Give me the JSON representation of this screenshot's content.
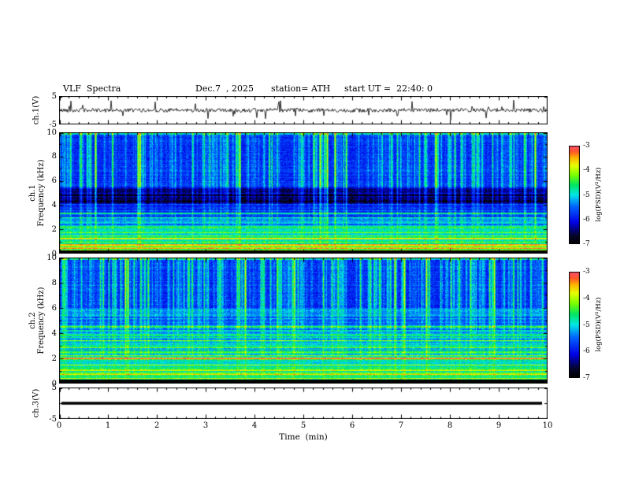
{
  "header": {
    "title": "VLF  Spectra",
    "date": "Dec.7  , 2025",
    "station": "station= ATH",
    "start_ut": "start UT =  22:40: 0"
  },
  "xaxis": {
    "label": "Time  (min)",
    "ticks": [
      "0",
      "1",
      "2",
      "3",
      "4",
      "5",
      "6",
      "7",
      "8",
      "9",
      "10"
    ]
  },
  "panels": {
    "wave1": {
      "ylabel": "ch.1(V)",
      "yticks": [
        "5",
        "-5"
      ],
      "ylim": [
        -5,
        5
      ]
    },
    "spec1": {
      "ylabel_ch": "ch.1",
      "ylabel_freq": "Frequency (kHz)",
      "yticks": [
        "10",
        "8",
        "6",
        "4",
        "2",
        "0"
      ],
      "ylim": [
        0,
        10
      ]
    },
    "spec2": {
      "ylabel_ch": "ch.2",
      "ylabel_freq": "Frequency (kHz)",
      "yticks": [
        "10",
        "8",
        "6",
        "4",
        "2",
        "0"
      ],
      "ylim": [
        0,
        10
      ]
    },
    "wave3": {
      "ylabel": "ch.3(V)",
      "yticks": [
        "5",
        "-5"
      ],
      "ylim": [
        -5,
        5
      ]
    }
  },
  "colorbars": {
    "label": "log(PSD)(V²/Hz)",
    "ticks": [
      "-3",
      "-4",
      "-5",
      "-6",
      "-7"
    ],
    "range": [
      -7,
      -3
    ]
  },
  "colors": {
    "background": "#ffffff",
    "axis": "#000000",
    "colormap_stops": [
      [
        0.0,
        "#000000"
      ],
      [
        0.08,
        "#050528"
      ],
      [
        0.22,
        "#0000e6"
      ],
      [
        0.38,
        "#0064ff"
      ],
      [
        0.5,
        "#00e6e6"
      ],
      [
        0.6,
        "#00e664"
      ],
      [
        0.7,
        "#78ff00"
      ],
      [
        0.8,
        "#e6ff00"
      ],
      [
        0.88,
        "#ffb400"
      ],
      [
        0.94,
        "#ff5a28"
      ],
      [
        1.0,
        "#ff506e"
      ]
    ]
  },
  "chart_data": [
    {
      "type": "line",
      "panel": "ch.1 time series",
      "xlabel": "Time (min)",
      "xlim": [
        0,
        10
      ],
      "ylabel": "ch.1(V)",
      "ylim": [
        -5,
        5
      ],
      "yticks": [
        5,
        -5
      ],
      "description": "Broadband noise trace centred near 0 V with frequent impulsive sferic spikes of roughly ±1 to ±3.5 V throughout the 10-minute record."
    },
    {
      "type": "heatmap",
      "panel": "ch.1 spectrogram",
      "xlabel": "Time (min)",
      "xlim": [
        0,
        10
      ],
      "ylabel": "Frequency (kHz)",
      "ylim": [
        0,
        10
      ],
      "yticks": [
        0,
        2,
        4,
        6,
        8,
        10
      ],
      "zlabel": "log(PSD)(V²/Hz)",
      "zlim": [
        -7,
        -3
      ],
      "bands": [
        {
          "f": [
            0,
            0.32
          ],
          "level": -7.2
        },
        {
          "f": [
            0.32,
            0.9
          ],
          "level": -4.55
        },
        {
          "f": [
            0.9,
            1.6
          ],
          "level": -4.8
        },
        {
          "f": [
            1.6,
            2.4
          ],
          "level": -5.05
        },
        {
          "f": [
            2.4,
            3.0
          ],
          "level": -5.4
        },
        {
          "f": [
            3.0,
            4.1
          ],
          "level": -5.9
        },
        {
          "f": [
            4.1,
            5.5
          ],
          "level": -6.5
        },
        {
          "f": [
            5.5,
            10
          ],
          "level": -5.85
        }
      ],
      "lines": [
        {
          "f": 9.95,
          "w": 0.1,
          "level": -5.1
        },
        {
          "f": 4.85,
          "w": 0.07,
          "level": -6.9
        },
        {
          "f": 4.35,
          "w": 0.07,
          "level": -6.9
        },
        {
          "f": 3.35,
          "w": 0.07,
          "level": -5.0
        },
        {
          "f": 3.0,
          "w": 0.06,
          "level": -5.15
        },
        {
          "f": 2.15,
          "w": 0.06,
          "level": -4.6
        },
        {
          "f": 1.75,
          "w": 0.06,
          "level": -4.5
        },
        {
          "f": 1.3,
          "w": 0.07,
          "level": -4.3
        },
        {
          "f": 1.0,
          "w": 0.06,
          "level": -4.35
        },
        {
          "f": 0.72,
          "w": 0.06,
          "level": -3.6
        },
        {
          "f": 0.5,
          "w": 0.05,
          "level": -3.9
        },
        {
          "f": 0.36,
          "w": 0.04,
          "level": -4.2
        }
      ],
      "streaks": {
        "prob": 0.45,
        "strong": 8,
        "mask": [
          {
            "f": [
              0.32,
              0.9
            ],
            "gain": 0.15
          },
          {
            "f": [
              0.9,
              2.4
            ],
            "gain": 0.25
          },
          {
            "f": [
              2.4,
              4.1
            ],
            "gain": 0.45
          },
          {
            "f": [
              4.1,
              5.5
            ],
            "gain": 0.75
          },
          {
            "f": [
              5.5,
              10
            ],
            "gain": 1.0
          }
        ]
      },
      "row_noise": [
        {
          "f": [
            0.32,
            2.4
          ],
          "amp": 0.5
        },
        {
          "f": [
            2.4,
            4.1
          ],
          "amp": 0.3
        },
        {
          "f": [
            4.1,
            5.5
          ],
          "amp": 0.25
        },
        {
          "f": [
            5.5,
            10
          ],
          "amp": 0.12
        }
      ],
      "features": [
        "dense vertical impulsive streaks (sferics) above ~5.5 kHz on a blue ~-6 background",
        "quiet dark-blue band between ~4.1 and 5.5 kHz",
        "green band with horizontal striations between ~1 and 3 kHz",
        "strong yellow-to-red narrow horizontal lines between ~0.4 and 1.8 kHz",
        "black band below ~0.3 kHz"
      ]
    },
    {
      "type": "heatmap",
      "panel": "ch.2 spectrogram",
      "xlabel": "Time (min)",
      "xlim": [
        0,
        10
      ],
      "ylabel": "Frequency (kHz)",
      "ylim": [
        0,
        10
      ],
      "yticks": [
        0,
        2,
        4,
        6,
        8,
        10
      ],
      "zlabel": "log(PSD)(V²/Hz)",
      "zlim": [
        -7,
        -3
      ],
      "bands": [
        {
          "f": [
            0,
            0.32
          ],
          "level": -7.2
        },
        {
          "f": [
            0.32,
            0.9
          ],
          "level": -4.45
        },
        {
          "f": [
            0.9,
            1.9
          ],
          "level": -4.8
        },
        {
          "f": [
            1.9,
            2.3
          ],
          "level": -4.5
        },
        {
          "f": [
            2.3,
            4.3
          ],
          "level": -5.15
        },
        {
          "f": [
            4.3,
            5.0
          ],
          "level": -5.55
        },
        {
          "f": [
            5.0,
            6.0
          ],
          "level": -5.6
        },
        {
          "f": [
            6.0,
            10
          ],
          "level": -5.85
        }
      ],
      "lines": [
        {
          "f": 9.95,
          "w": 0.1,
          "level": -5.1
        },
        {
          "f": 4.55,
          "w": 0.07,
          "level": -4.9
        },
        {
          "f": 3.9,
          "w": 0.07,
          "level": -4.7
        },
        {
          "f": 3.4,
          "w": 0.07,
          "level": -4.7
        },
        {
          "f": 2.9,
          "w": 0.07,
          "level": -4.6
        },
        {
          "f": 2.5,
          "w": 0.06,
          "level": -4.5
        },
        {
          "f": 2.05,
          "w": 0.07,
          "level": -3.5
        },
        {
          "f": 1.5,
          "w": 0.06,
          "level": -4.25
        },
        {
          "f": 1.1,
          "w": 0.06,
          "level": -4.2
        },
        {
          "f": 0.75,
          "w": 0.06,
          "level": -3.5
        },
        {
          "f": 0.45,
          "w": 0.05,
          "level": -4.0
        },
        {
          "f": 0.36,
          "w": 0.04,
          "level": -4.2
        }
      ],
      "streaks": {
        "prob": 0.5,
        "strong": 8,
        "mask": [
          {
            "f": [
              0.32,
              0.9
            ],
            "gain": 0.12
          },
          {
            "f": [
              0.9,
              2.3
            ],
            "gain": 0.2
          },
          {
            "f": [
              2.3,
              4.3
            ],
            "gain": 0.35
          },
          {
            "f": [
              4.3,
              6
            ],
            "gain": 0.6
          },
          {
            "f": [
              6,
              10
            ],
            "gain": 1.0
          }
        ]
      },
      "row_noise": [
        {
          "f": [
            0.32,
            2.3
          ],
          "amp": 0.5
        },
        {
          "f": [
            2.3,
            4.3
          ],
          "amp": 0.4
        },
        {
          "f": [
            4.3,
            6
          ],
          "amp": 0.3
        },
        {
          "f": [
            6,
            10
          ],
          "amp": 0.12
        }
      ],
      "features": [
        "dense vertical impulsive streaks (sferics) above ~6 kHz on a blue ~-6 background",
        "greenish band with horizontal striations between ~2.3 and 4.3 kHz",
        "strong red/orange horizontal lines near ~2.0 and ~0.75 kHz",
        "yellow-green banding between ~0.4 and 1.9 kHz",
        "black band below ~0.3 kHz"
      ]
    },
    {
      "type": "line",
      "panel": "ch.3 time series",
      "xlabel": "Time (min)",
      "xlim": [
        0,
        10
      ],
      "ylabel": "ch.3(V)",
      "ylim": [
        -5,
        5
      ],
      "yticks": [
        5,
        -5
      ],
      "description": "Flat constant trace at 0 V drawn as a thick black line (channel off / no signal)."
    }
  ]
}
